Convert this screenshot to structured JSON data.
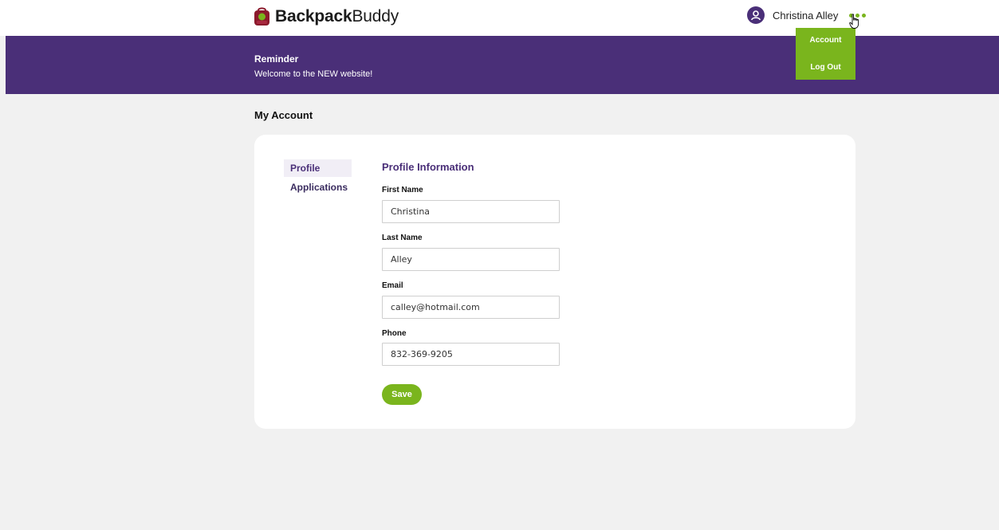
{
  "header": {
    "logo_bold": "Backpack",
    "logo_light": "Buddy",
    "user_name": "Christina Alley"
  },
  "dropdown": {
    "items": [
      "Account",
      "Log Out"
    ]
  },
  "banner": {
    "title": "Reminder",
    "text": "Welcome to the NEW website!"
  },
  "page": {
    "title": "My Account"
  },
  "side_nav": {
    "items": [
      "Profile",
      "Applications"
    ],
    "active": "Profile"
  },
  "form": {
    "title": "Profile Information",
    "fields": [
      {
        "label": "First Name",
        "value": "Christina"
      },
      {
        "label": "Last Name",
        "value": "Alley"
      },
      {
        "label": "Email",
        "value": "calley@hotmail.com"
      },
      {
        "label": "Phone",
        "value": "832-369-9205"
      }
    ],
    "save_label": "Save"
  },
  "colors": {
    "brand_purple": "#4a2f78",
    "accent_green": "#7ab51d",
    "page_bg": "#f1f1f1"
  }
}
